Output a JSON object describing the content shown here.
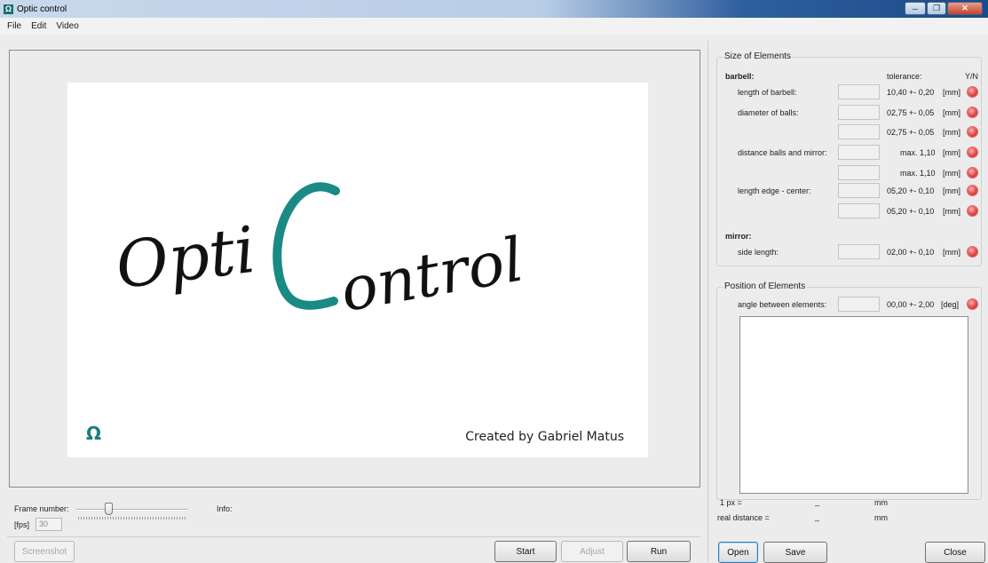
{
  "window": {
    "title": "Optic control",
    "icon": "omega-icon"
  },
  "menu": [
    "File",
    "Edit",
    "Video"
  ],
  "splash": {
    "logo_part1": "Opti",
    "logo_part2": "C",
    "logo_part3": "ontrol",
    "credit": "Created by Gabriel Matus",
    "accent_color": "#1a8a84"
  },
  "controls": {
    "frame_number_label": "Frame number:",
    "fps_label": "[fps]",
    "fps_value": "30",
    "info_label": "Info:",
    "slider_level": 0.25
  },
  "buttons": {
    "screenshot": "Screenshot",
    "start": "Start",
    "adjust": "Adjust",
    "run": "Run",
    "open": "Open",
    "save": "Save",
    "close": "Close"
  },
  "size_group": {
    "title": "Size of Elements",
    "barbell_label": "barbell:",
    "tolerance_header": "tolerance:",
    "yn_header": "Y/N",
    "mirror_label": "mirror:",
    "rows": [
      {
        "label": "length of barbell:",
        "tolerance": "10,40 +- 0,20",
        "unit": "[mm]"
      },
      {
        "label": "diameter of balls:",
        "tolerance": "02,75 +- 0,05",
        "unit": "[mm]"
      },
      {
        "label": "",
        "tolerance": "02,75 +- 0,05",
        "unit": "[mm]"
      },
      {
        "label": "distance balls and mirror:",
        "tolerance": "max. 1,10",
        "unit": "[mm]"
      },
      {
        "label": "",
        "tolerance": "max. 1,10",
        "unit": "[mm]"
      },
      {
        "label": "length edge - center:",
        "tolerance": "05,20 +- 0,10",
        "unit": "[mm]"
      },
      {
        "label": "",
        "tolerance": "05,20 +- 0,10",
        "unit": "[mm]"
      },
      {
        "label": "side length:",
        "tolerance": "02,00 +- 0,10",
        "unit": "[mm]"
      }
    ]
  },
  "position_group": {
    "title": "Position of Elements",
    "row": {
      "label": "angle between elements:",
      "tolerance": "00,00 +- 2,00",
      "unit": "[deg]"
    }
  },
  "calibration": {
    "px_label": "1 px =",
    "px_value": "_",
    "px_unit": "mm",
    "real_label": "real distance =",
    "real_value": "_",
    "real_unit": "mm"
  },
  "colors": {
    "status_fail": "#e04848",
    "titlebar_dark": "#1d4a8a"
  }
}
